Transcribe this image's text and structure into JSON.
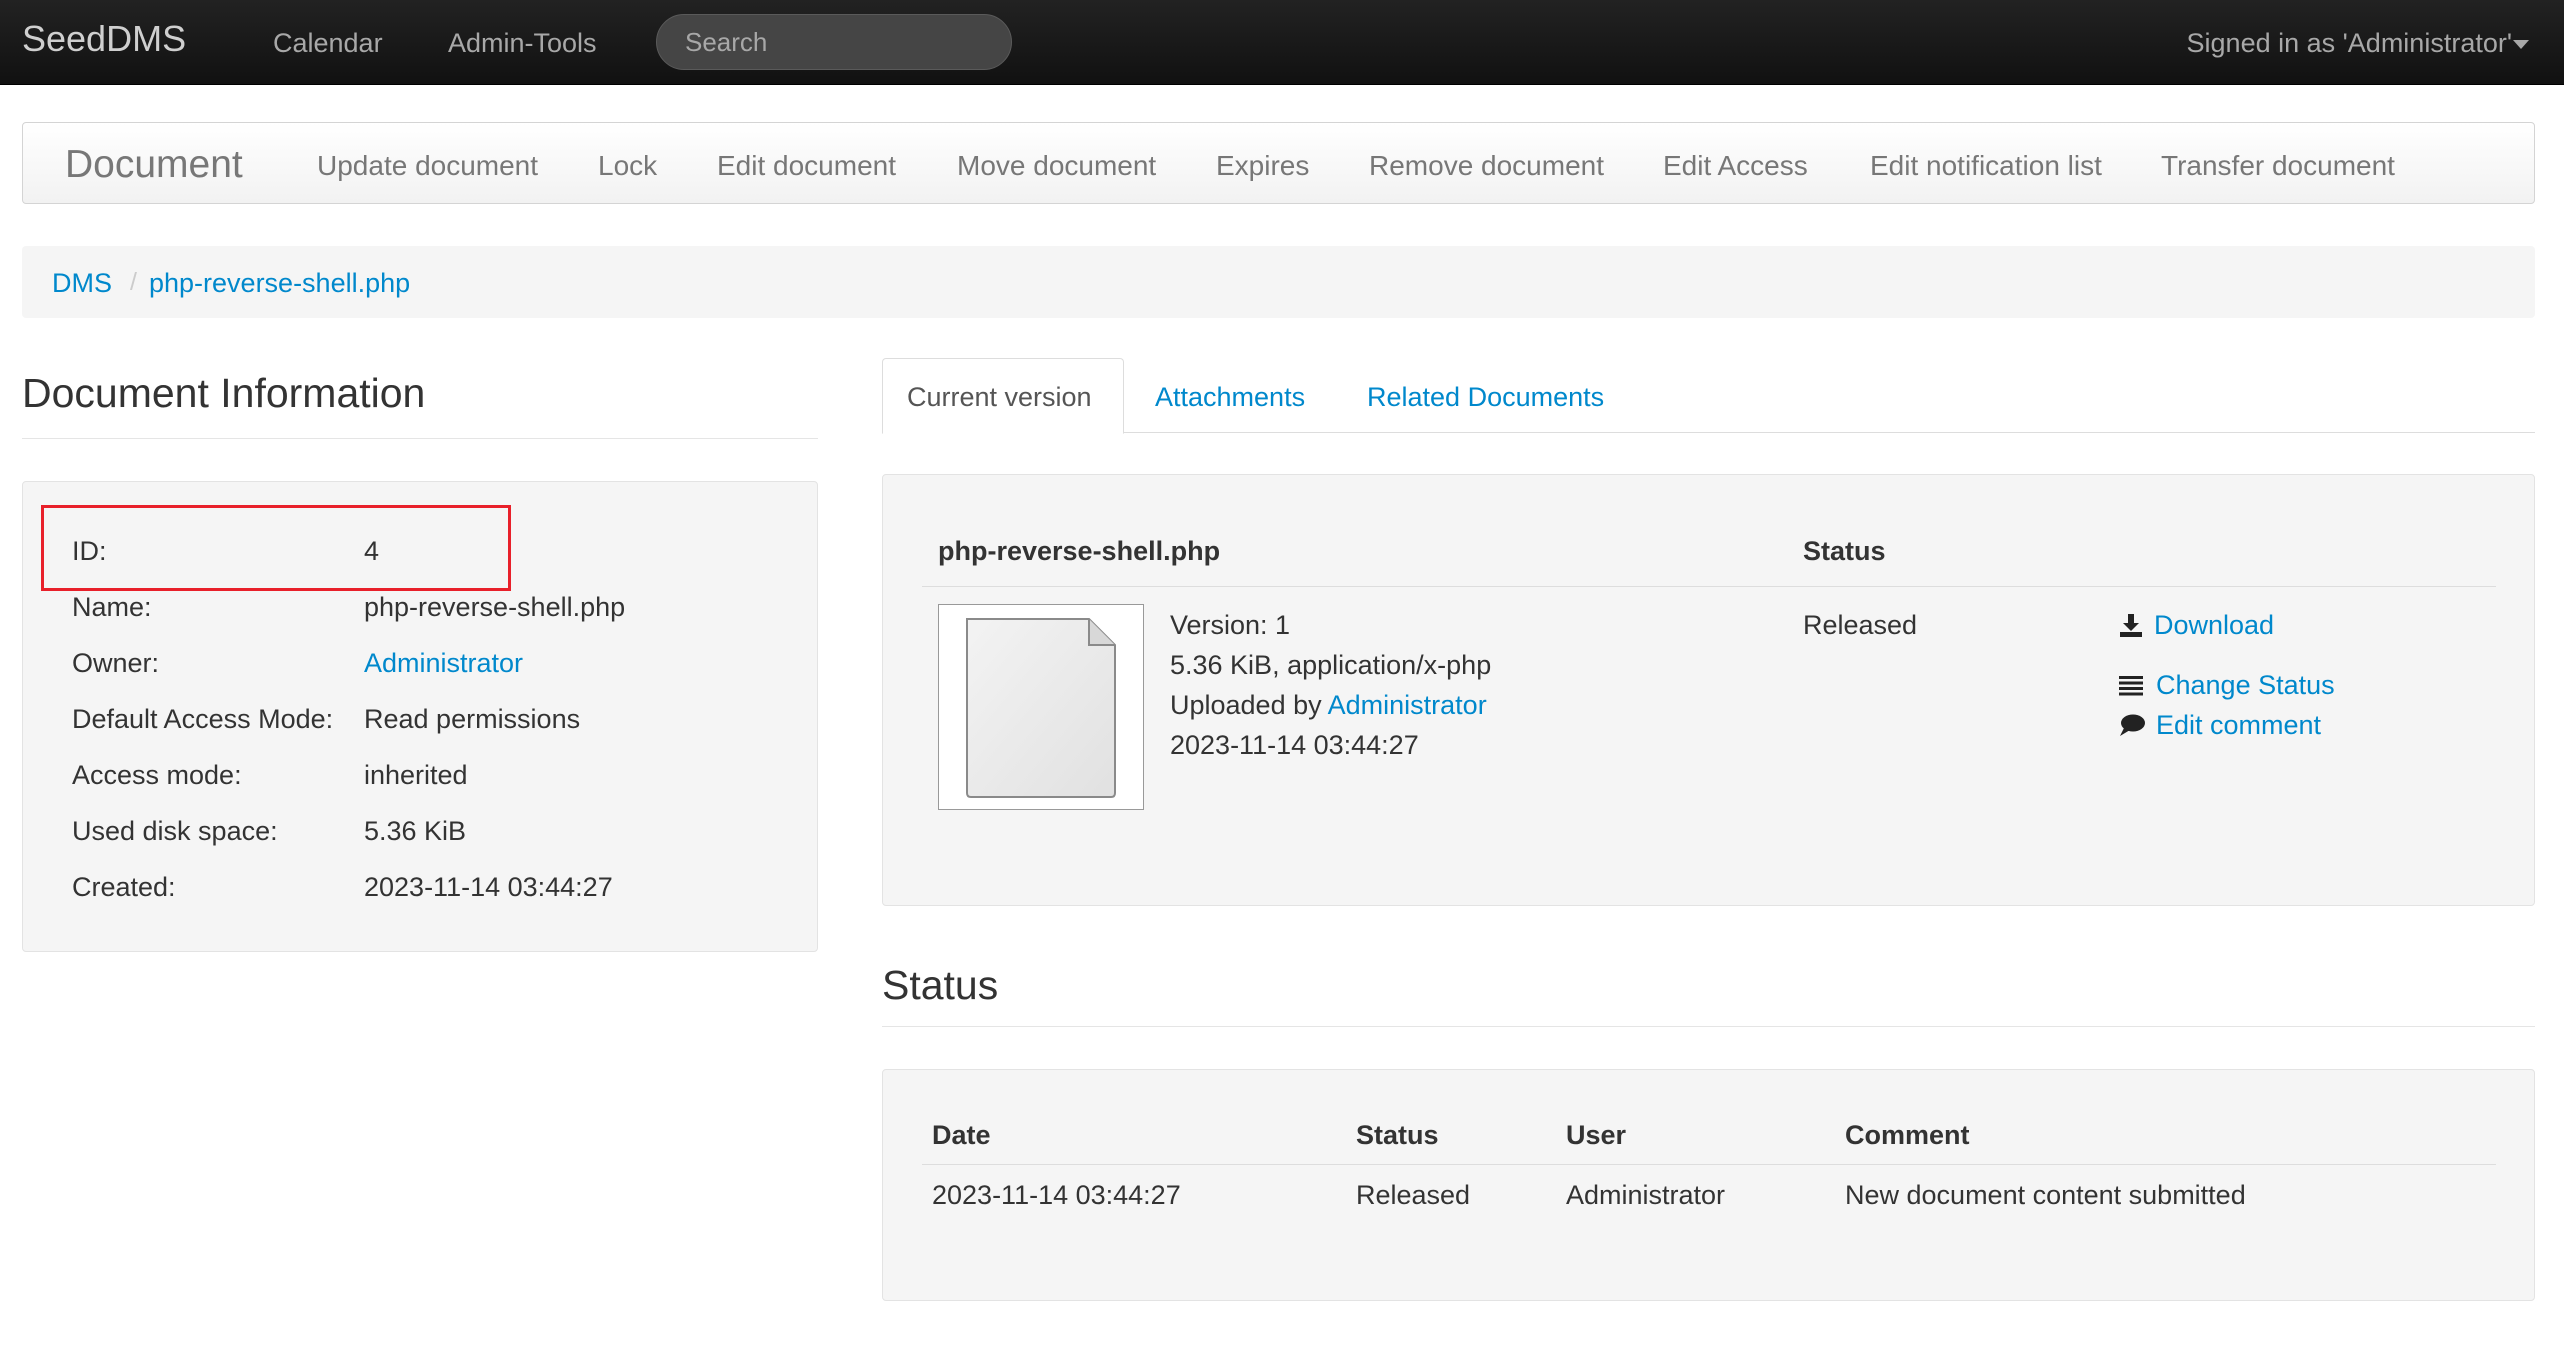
{
  "topbar": {
    "brand": "SeedDMS",
    "nav": [
      "Calendar",
      "Admin-Tools"
    ],
    "search_placeholder": "Search",
    "signed_in": "Signed in as 'Administrator'"
  },
  "docbar": {
    "title": "Document",
    "items": [
      "Update document",
      "Lock",
      "Edit document",
      "Move document",
      "Expires",
      "Remove document",
      "Edit Access",
      "Edit notification list",
      "Transfer document"
    ]
  },
  "breadcrumb": {
    "root": "DMS",
    "separator": "/",
    "current": "php-reverse-shell.php"
  },
  "doc_info": {
    "heading": "Document Information",
    "rows": [
      {
        "label": "ID:",
        "value": "4"
      },
      {
        "label": "Name:",
        "value": "php-reverse-shell.php"
      },
      {
        "label": "Owner:",
        "value": "Administrator"
      },
      {
        "label": "Default Access Mode:",
        "value": "Read permissions"
      },
      {
        "label": "Access mode:",
        "value": "inherited"
      },
      {
        "label": "Used disk space:",
        "value": "5.36 KiB"
      },
      {
        "label": "Created:",
        "value": "2023-11-14 03:44:27"
      }
    ]
  },
  "tabs": [
    "Current version",
    "Attachments",
    "Related Documents"
  ],
  "version": {
    "col_file": "php-reverse-shell.php",
    "col_status": "Status",
    "version_line": "Version: 1",
    "size_line": "5.36 KiB, application/x-php",
    "uploaded_prefix": "Uploaded by",
    "uploaded_user": "Administrator",
    "date": "2023-11-14 03:44:27",
    "status": "Released",
    "actions": [
      "Download",
      "Change Status",
      "Edit comment"
    ]
  },
  "status_section": {
    "heading": "Status",
    "headers": [
      "Date",
      "Status",
      "User",
      "Comment"
    ],
    "rows": [
      [
        "2023-11-14 03:44:27",
        "Released",
        "Administrator",
        "New document content submitted"
      ]
    ]
  }
}
